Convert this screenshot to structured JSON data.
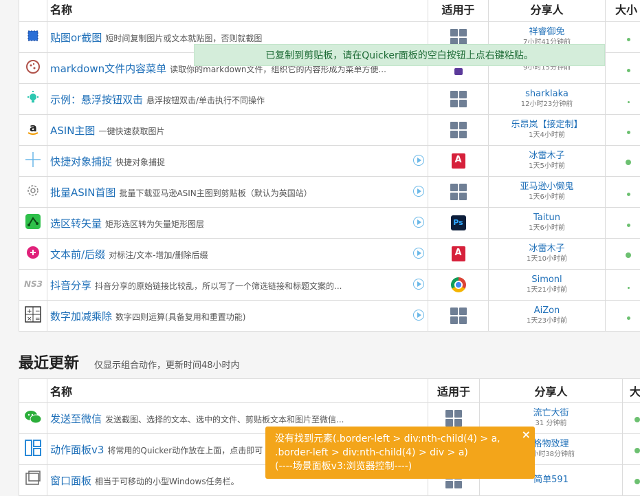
{
  "colors": {
    "link": "#1e6fb8",
    "toast_success_bg": "#d4edda",
    "toast_warn_bg": "#f3a51a",
    "size_dot": "#6cc070"
  },
  "table1": {
    "headers": {
      "name": "名称",
      "app": "适用于",
      "share": "分享人",
      "size": "大小"
    },
    "rows": [
      {
        "icon": "selection-icon",
        "name": "贴图or截图",
        "desc": "短时间复制图片或文本就贴图，否则就截图",
        "app": "windows-icon",
        "sharer": "祥睿御免",
        "time": "7小时41分钟前"
      },
      {
        "icon": "cookie-icon",
        "name": "markdown文件内容菜单",
        "desc": "读取你的markdown文件，组织它的内容形成为菜单方便...",
        "app": "purple-app-icon",
        "sharer": "",
        "time": "9小时15分钟前"
      },
      {
        "icon": "bulb-icon",
        "name": "示例：悬浮按钮双击",
        "desc": "悬浮按钮双击/单击执行不同操作",
        "app": "windows-icon",
        "sharer": "sharklaka",
        "time": "12小时23分钟前"
      },
      {
        "icon": "amazon-icon",
        "name": "ASIN主图",
        "desc": "一键快速获取图片",
        "app": "windows-icon",
        "sharer": "乐昂岚【接定制】",
        "time": "1天4小时前"
      },
      {
        "icon": "crosshair-icon",
        "name": "快捷对象捕捉",
        "desc": "快捷对象捕捉",
        "app": "autocad-icon",
        "sharer": "冰雷木子",
        "time": "1天5小时前"
      },
      {
        "icon": "gear-icon",
        "name": "批量ASIN首图",
        "desc": "批量下载亚马逊ASIN主图到剪贴板（默认为英国站）",
        "app": "windows-icon",
        "sharer": "亚马逊小懒鬼",
        "time": "1天6小时前"
      },
      {
        "icon": "vector-icon",
        "name": "选区转矢量",
        "desc": "矩形选区转为矢量矩形图层",
        "app": "photoshop-icon",
        "sharer": "Taitun",
        "time": "1天6小时前"
      },
      {
        "icon": "plus-circle-icon",
        "name": "文本前/后缀",
        "desc": "对标注/文本-增加/删除后缀",
        "app": "autocad-icon",
        "sharer": "冰雷木子",
        "time": "1天10小时前"
      },
      {
        "icon": "ns-logo-icon",
        "name": "抖音分享",
        "desc": "抖音分享的原始链接比较乱，所以写了一个筛选链接和标题文案的...",
        "app": "chrome-icon",
        "sharer": "Simonl",
        "time": "1天21小时前"
      },
      {
        "icon": "calculator-icon",
        "name": "数字加减乘除",
        "desc": "数字四则运算(具备复用和重置功能)",
        "app": "windows-icon",
        "sharer": "AiZon",
        "time": "1天23小时前"
      }
    ]
  },
  "recent": {
    "title": "最近更新",
    "subtitle": "仅显示组合动作，更新时间48小时内"
  },
  "table2": {
    "headers": {
      "name": "名称",
      "app": "适用于",
      "share": "分享人",
      "size": "大"
    },
    "rows": [
      {
        "icon": "wechat-icon",
        "name": "发送至微信",
        "desc": "发送截图、选择的文本、选中的文件、剪贴板文本和图片至微信...",
        "app": "windows-icon",
        "sharer": "流亡大街",
        "time": "31 分钟前"
      },
      {
        "icon": "panel-icon",
        "name": "动作面板v3",
        "desc": "将常用的Quicker动作放在上面，点击即可",
        "app": "windows-icon",
        "sharer": "格物致理",
        "time": "1小时38分钟前"
      },
      {
        "icon": "window-icon",
        "name": "窗口面板",
        "desc": "相当于可移动的小型Windows任务栏。",
        "app": "windows-icon",
        "sharer": "简单591",
        "time": ""
      }
    ]
  },
  "toast_success": "已复制到剪贴板，请在Quicker面板的空白按钮上点右键粘贴。",
  "toast_error": {
    "line1": "没有找到元素(.border-left > div:nth-child(4) > a,",
    "line2": ".border-left > div:nth-child(4) > div > a)",
    "line3": "(----场景面板v3:浏览器控制----)",
    "close": "×"
  }
}
